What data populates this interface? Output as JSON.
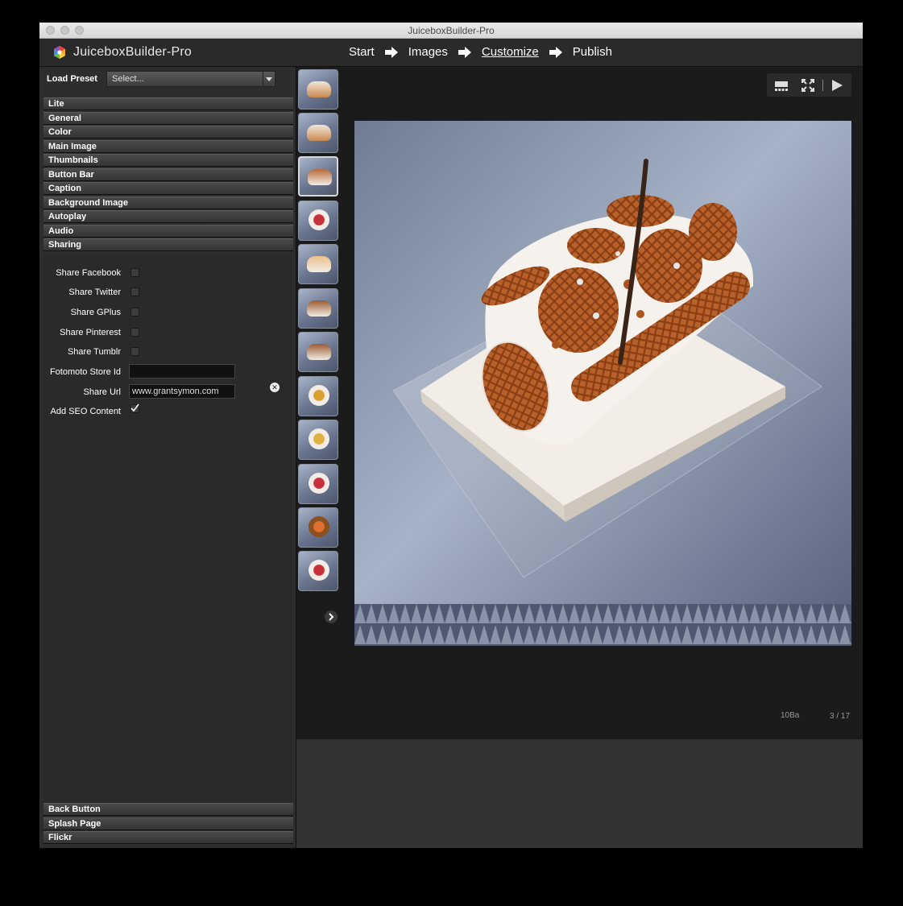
{
  "window": {
    "title": "JuiceboxBuilder-Pro"
  },
  "header": {
    "app_name": "JuiceboxBuilder-Pro",
    "steps": [
      {
        "label": "Start",
        "active": false
      },
      {
        "label": "Images",
        "active": false
      },
      {
        "label": "Customize",
        "active": true
      },
      {
        "label": "Publish",
        "active": false
      }
    ]
  },
  "left_panel": {
    "preset_label": "Load Preset",
    "preset_value": "Select...",
    "sections_top": [
      "Lite",
      "General",
      "Color",
      "Main Image",
      "Thumbnails",
      "Button Bar",
      "Caption",
      "Background Image",
      "Autoplay",
      "Audio",
      "Sharing"
    ],
    "sharing_fields": {
      "share_facebook": {
        "label": "Share Facebook",
        "checked": false
      },
      "share_twitter": {
        "label": "Share Twitter",
        "checked": false
      },
      "share_gplus": {
        "label": "Share GPlus",
        "checked": false
      },
      "share_pinterest": {
        "label": "Share Pinterest",
        "checked": false
      },
      "share_tumblr": {
        "label": "Share Tumblr",
        "checked": false
      },
      "fotomoto": {
        "label": "Fotomoto Store Id",
        "value": ""
      },
      "share_url": {
        "label": "Share Url",
        "value": "www.grantsymon.com"
      },
      "add_seo": {
        "label": "Add SEO Content",
        "checked": true
      }
    },
    "sections_bottom": [
      "Back Button",
      "Splash Page",
      "Flickr"
    ]
  },
  "thumbnails": {
    "count_visible": 12,
    "selected_index": 2
  },
  "viewer": {
    "caption": "10Ba",
    "counter": "3 / 17",
    "toolbar_icons": [
      "thumbnails-toggle-icon",
      "fullscreen-icon",
      "play-icon"
    ]
  },
  "colors": {
    "panel": "#2d2d2d",
    "section_header": "#3f3f3f",
    "viewer_bg": "#1b1b1b"
  }
}
